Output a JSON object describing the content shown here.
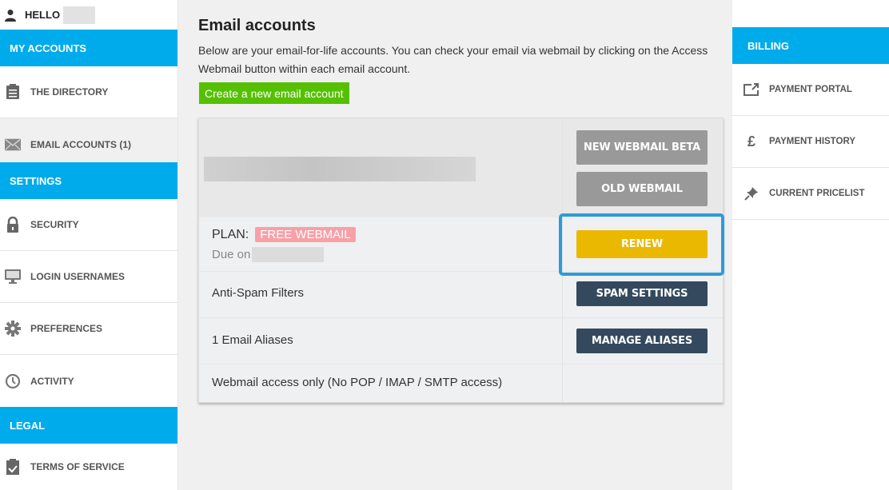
{
  "header": {
    "greeting": "HELLO"
  },
  "left_sidebar": {
    "sections": [
      {
        "title": "MY ACCOUNTS",
        "items": [
          {
            "label": "THE DIRECTORY",
            "icon": "clipboard-icon"
          },
          {
            "label": "EMAIL ACCOUNTS (1)",
            "icon": "envelope-icon",
            "active": true
          }
        ]
      },
      {
        "title": "SETTINGS",
        "items": [
          {
            "label": "SECURITY",
            "icon": "lock-icon"
          },
          {
            "label": "LOGIN USERNAMES",
            "icon": "monitor-icon"
          },
          {
            "label": "PREFERENCES",
            "icon": "gear-icon"
          },
          {
            "label": "ACTIVITY",
            "icon": "clock-icon"
          }
        ]
      },
      {
        "title": "LEGAL",
        "items": [
          {
            "label": "TERMS OF SERVICE",
            "icon": "clipboard-check-icon"
          }
        ]
      }
    ]
  },
  "main": {
    "title": "Email accounts",
    "description": "Below are your email-for-life accounts. You can check your email via webmail by clicking on the Access Webmail button within each email account.",
    "create_button": "Create a new email account",
    "account": {
      "buttons": {
        "new_webmail": "NEW WEBMAIL BETA",
        "old_webmail": "OLD WEBMAIL",
        "renew": "RENEW",
        "spam_settings": "SPAM SETTINGS",
        "manage_aliases": "MANAGE ALIASES"
      },
      "plan_label": "PLAN:",
      "plan_value": "FREE WEBMAIL",
      "due_label": "Due on",
      "anti_spam": "Anti-Spam Filters",
      "aliases": "1 Email Aliases",
      "access_note": "Webmail access only (No POP / IMAP / SMTP access)"
    }
  },
  "right_sidebar": {
    "title": "BILLING",
    "items": [
      {
        "label": "PAYMENT PORTAL",
        "icon": "external-link-icon"
      },
      {
        "label": "PAYMENT HISTORY",
        "icon": "pound-icon"
      },
      {
        "label": "CURRENT PRICELIST",
        "icon": "pin-icon"
      }
    ]
  },
  "colors": {
    "accent": "#00abeb",
    "create": "#55c000",
    "renew": "#ebb800",
    "navy": "#34495e",
    "badge": "#f7a0a8",
    "highlight": "#2e9bd6"
  }
}
